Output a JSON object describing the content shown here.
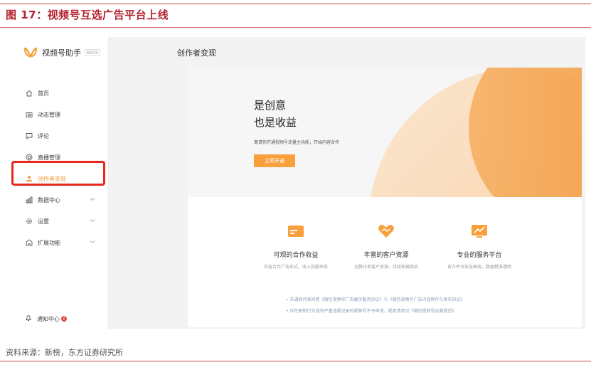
{
  "figure": {
    "title": "图 17：视频号互选广告平台上线",
    "source": "资料来源：新榜，东方证券研究所"
  },
  "app": {
    "name": "视频号助手",
    "beta": "Beta",
    "page_title": "创作者变现"
  },
  "sidebar": {
    "items": [
      {
        "label": "首页",
        "icon": "home-icon"
      },
      {
        "label": "动态管理",
        "icon": "camera-icon"
      },
      {
        "label": "评论",
        "icon": "comment-icon"
      },
      {
        "label": "直播管理",
        "icon": "live-icon"
      },
      {
        "label": "创作者变现",
        "icon": "monetize-icon",
        "active": true
      },
      {
        "label": "数据中心",
        "icon": "chart-icon",
        "expandable": true
      },
      {
        "label": "设置",
        "icon": "gear-icon",
        "expandable": true
      },
      {
        "label": "扩展功能",
        "icon": "extension-icon",
        "expandable": true
      }
    ],
    "notification": {
      "label": "通知中心",
      "count": "2"
    }
  },
  "hero": {
    "line1": "是创意",
    "line2": "也是收益",
    "subtitle": "邀请你开通视频号流量主功能，开始内容合作",
    "button": "立即开通"
  },
  "features": [
    {
      "title": "可观的合作收益",
      "desc": "内容合作广告形式，收入回报丰厚",
      "icon": "card-icon"
    },
    {
      "title": "丰富的客户资源",
      "desc": "全腾讯系客户资源，持续拓展商机",
      "icon": "handshake-icon"
    },
    {
      "title": "专业的服务平台",
      "desc": "官方平台安全高效，数据精准透明",
      "icon": "trend-icon"
    }
  ],
  "notes": [
    "• 开通即代表同意《微信视频号广告展示服务协议》与《微信视频号广告内容制作与发布协议》",
    "• 存在刷粉行为或有严重违规记录的视频号不予申请，规则请参见《微信视频号运营规范》"
  ],
  "colors": {
    "accent": "#f7a03c",
    "highlight": "#e8281f",
    "title": "#b5212e"
  }
}
